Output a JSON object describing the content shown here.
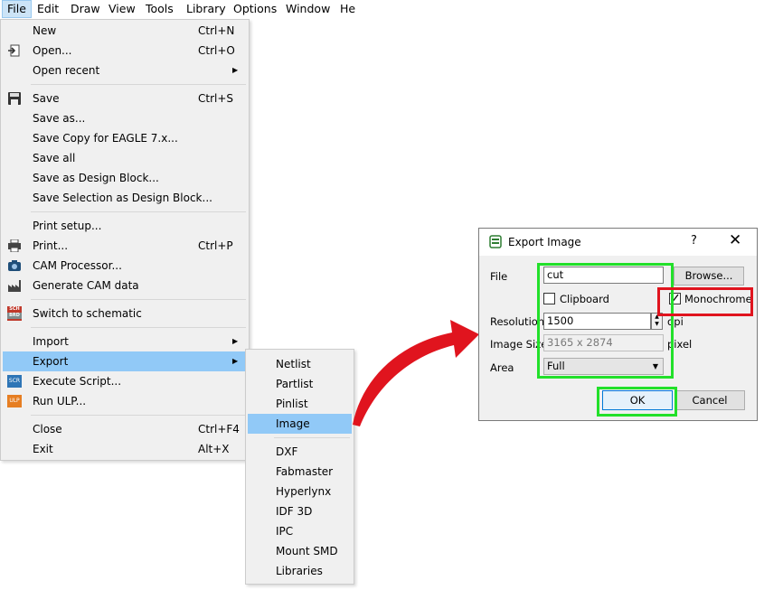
{
  "menubar": [
    {
      "label": "File",
      "active": true
    },
    {
      "label": "Edit"
    },
    {
      "label": "Draw"
    },
    {
      "label": "View"
    },
    {
      "label": "Tools"
    },
    {
      "label": "Library"
    },
    {
      "label": "Options"
    },
    {
      "label": "Window"
    },
    {
      "label": "He"
    }
  ],
  "file_menu": {
    "new": {
      "label": "New",
      "shortcut": "Ctrl+N"
    },
    "open": {
      "label": "Open...",
      "shortcut": "Ctrl+O",
      "icon": "open-icon"
    },
    "open_recent": {
      "label": "Open recent"
    },
    "save": {
      "label": "Save",
      "shortcut": "Ctrl+S",
      "icon": "floppy-disk-icon"
    },
    "save_as": {
      "label": "Save as..."
    },
    "save_copy": {
      "label": "Save Copy for EAGLE 7.x..."
    },
    "save_all": {
      "label": "Save all"
    },
    "save_design_block": {
      "label": "Save as Design Block..."
    },
    "save_selection_block": {
      "label": "Save Selection as Design Block..."
    },
    "print_setup": {
      "label": "Print setup..."
    },
    "print": {
      "label": "Print...",
      "shortcut": "Ctrl+P",
      "icon": "printer-icon"
    },
    "cam_processor": {
      "label": "CAM Processor...",
      "icon": "camera-icon"
    },
    "generate_cam": {
      "label": "Generate CAM data",
      "icon": "factory-icon"
    },
    "switch_schematic": {
      "label": "Switch to schematic",
      "icon": "sch-brd-icon",
      "icon_text": [
        "SCH",
        "BRD"
      ]
    },
    "import": {
      "label": "Import"
    },
    "export": {
      "label": "Export"
    },
    "execute_script": {
      "label": "Execute Script...",
      "icon": "scr-icon",
      "icon_text": "SCR"
    },
    "run_ulp": {
      "label": "Run ULP...",
      "icon": "ulp-icon",
      "icon_text": "ULP"
    },
    "close": {
      "label": "Close",
      "shortcut": "Ctrl+F4"
    },
    "exit": {
      "label": "Exit",
      "shortcut": "Alt+X"
    }
  },
  "export_submenu": {
    "netlist": "Netlist",
    "partlist": "Partlist",
    "pinlist": "Pinlist",
    "image": "Image",
    "dxf": "DXF",
    "fabmaster": "Fabmaster",
    "hyperlynx": "Hyperlynx",
    "idf3d": "IDF 3D",
    "ipc": "IPC",
    "mount_smd": "Mount SMD",
    "libraries": "Libraries"
  },
  "dialog": {
    "title": "Export Image",
    "help": "?",
    "close": "✕",
    "file_label": "File",
    "file_value": "cut",
    "browse_label": "Browse...",
    "clipboard_label": "Clipboard",
    "monochrome_label": "Monochrome",
    "resolution_label": "Resolution",
    "resolution_value": "1500",
    "resolution_unit": "dpi",
    "image_size_label": "Image Size",
    "image_size_value": "3165 x 2874",
    "image_size_unit": "pixel",
    "area_label": "Area",
    "area_value": "Full",
    "ok_label": "OK",
    "cancel_label": "Cancel"
  },
  "colors": {
    "highlight_green": "#22e02a",
    "highlight_red": "#e0141e",
    "arrow_red": "#e0141e",
    "menu_hover": "#91c9f7"
  }
}
